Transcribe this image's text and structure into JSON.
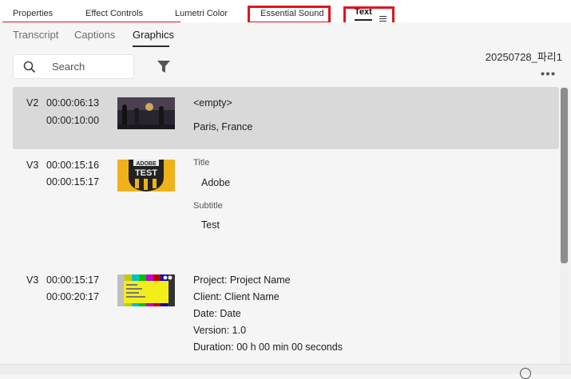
{
  "panel_tabs": [
    {
      "label": "Properties"
    },
    {
      "label": "Effect Controls"
    },
    {
      "label": "Lumetri Color"
    },
    {
      "label": "Essential Sound"
    },
    {
      "label": "Text"
    }
  ],
  "sub_tabs": [
    {
      "label": "Transcript"
    },
    {
      "label": "Captions"
    },
    {
      "label": "Graphics"
    }
  ],
  "sequence_name": "20250728_파리1",
  "search": {
    "placeholder": "Search"
  },
  "items": [
    {
      "track": "V2",
      "in": "00:00:06:13",
      "out": "00:00:10:00",
      "thumbnail": "paris-street-image",
      "fields": [
        {
          "label": "",
          "value": "<empty>"
        },
        {
          "label": "",
          "value": "Paris, France"
        }
      ]
    },
    {
      "track": "V3",
      "in": "00:00:15:16",
      "out": "00:00:15:17",
      "thumbnail": "adobe-test-badge-image",
      "fields": [
        {
          "label": "Title",
          "value": "Adobe"
        },
        {
          "label": "Subtitle",
          "value": "Test"
        }
      ]
    },
    {
      "track": "V3",
      "in": "00:00:15:17",
      "out": "00:00:20:17",
      "thumbnail": "slate-color-bars-image",
      "fields": [
        {
          "label": "",
          "value": "Project: Project Name"
        },
        {
          "label": "",
          "value": "Client: Client Name"
        },
        {
          "label": "",
          "value": "Date: Date"
        },
        {
          "label": "",
          "value": "Version: 1.0"
        },
        {
          "label": "",
          "value": "Duration: 00 h 00 min 00 seconds"
        }
      ]
    }
  ],
  "thumb_text": {
    "badge_top": "ADOBE",
    "badge_main": "TEST"
  },
  "colors": {
    "highlight_box": "#e0141e",
    "selected_row": "#d9d9d9"
  }
}
